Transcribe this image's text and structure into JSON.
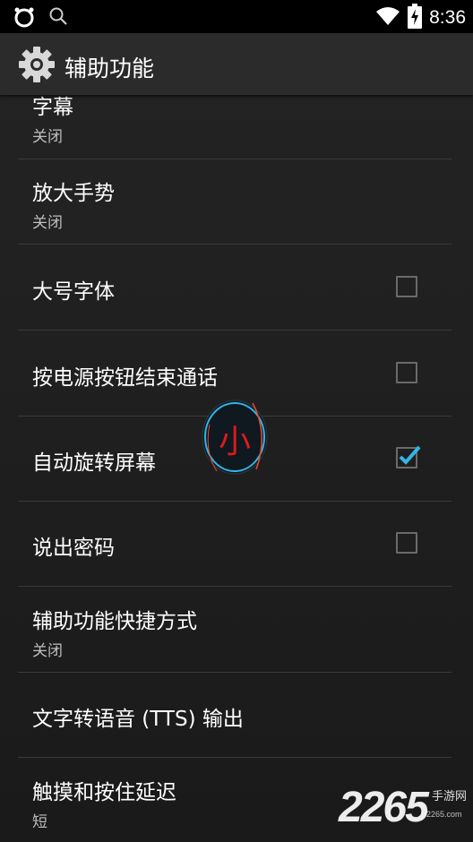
{
  "status_bar": {
    "time": "8:36",
    "icons": [
      "circle-app-icon",
      "search-icon",
      "wifi-icon",
      "battery-charging-icon"
    ]
  },
  "action_bar": {
    "title": "辅助功能",
    "icon": "gear-icon"
  },
  "settings": [
    {
      "title": "字幕",
      "summary": "关闭"
    },
    {
      "title": "放大手势",
      "summary": "关闭"
    },
    {
      "title": "大号字体",
      "checked": false
    },
    {
      "title": "按电源按钮结束通话",
      "checked": false
    },
    {
      "title": "自动旋转屏幕",
      "checked": true
    },
    {
      "title": "说出密码",
      "checked": false
    },
    {
      "title": "辅助功能快捷方式",
      "summary": "关闭"
    },
    {
      "title": "文字转语音 (TTS) 输出"
    },
    {
      "title": "触摸和按住延迟",
      "summary": "短"
    }
  ],
  "floating_ball": {
    "label": "小"
  },
  "watermark": {
    "number": "2265",
    "text": "手游网",
    "url": "2265.com"
  },
  "colors": {
    "accent": "#33b5e5",
    "background": "#212121",
    "floating_label": "#e01a1a"
  }
}
